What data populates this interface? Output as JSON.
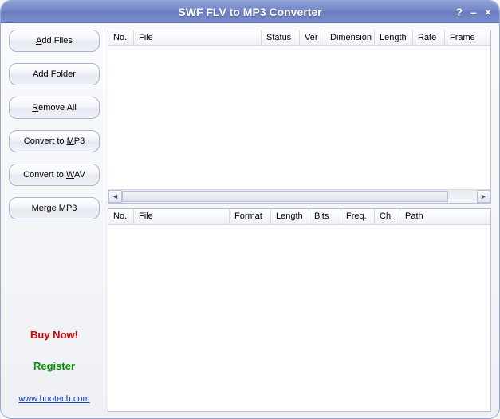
{
  "window": {
    "title": "SWF FLV to MP3 Converter"
  },
  "sidebar": {
    "add_files": "Add Files",
    "add_folder": "Add Folder",
    "remove_all": "Remove All",
    "convert_mp3": "Convert to MP3",
    "convert_wav": "Convert to WAV",
    "merge_mp3": "Merge MP3",
    "buy_now": "Buy Now!",
    "register": "Register",
    "website": "www.hootech.com"
  },
  "top_list": {
    "columns": {
      "no": "No.",
      "file": "File",
      "status": "Status",
      "ver": "Ver",
      "dimension": "Dimension",
      "length": "Length",
      "rate": "Rate",
      "frame": "Frame"
    },
    "rows": []
  },
  "bottom_list": {
    "columns": {
      "no": "No.",
      "file": "File",
      "format": "Format",
      "length": "Length",
      "bits": "Bits",
      "freq": "Freq.",
      "ch": "Ch.",
      "path": "Path"
    },
    "rows": []
  }
}
